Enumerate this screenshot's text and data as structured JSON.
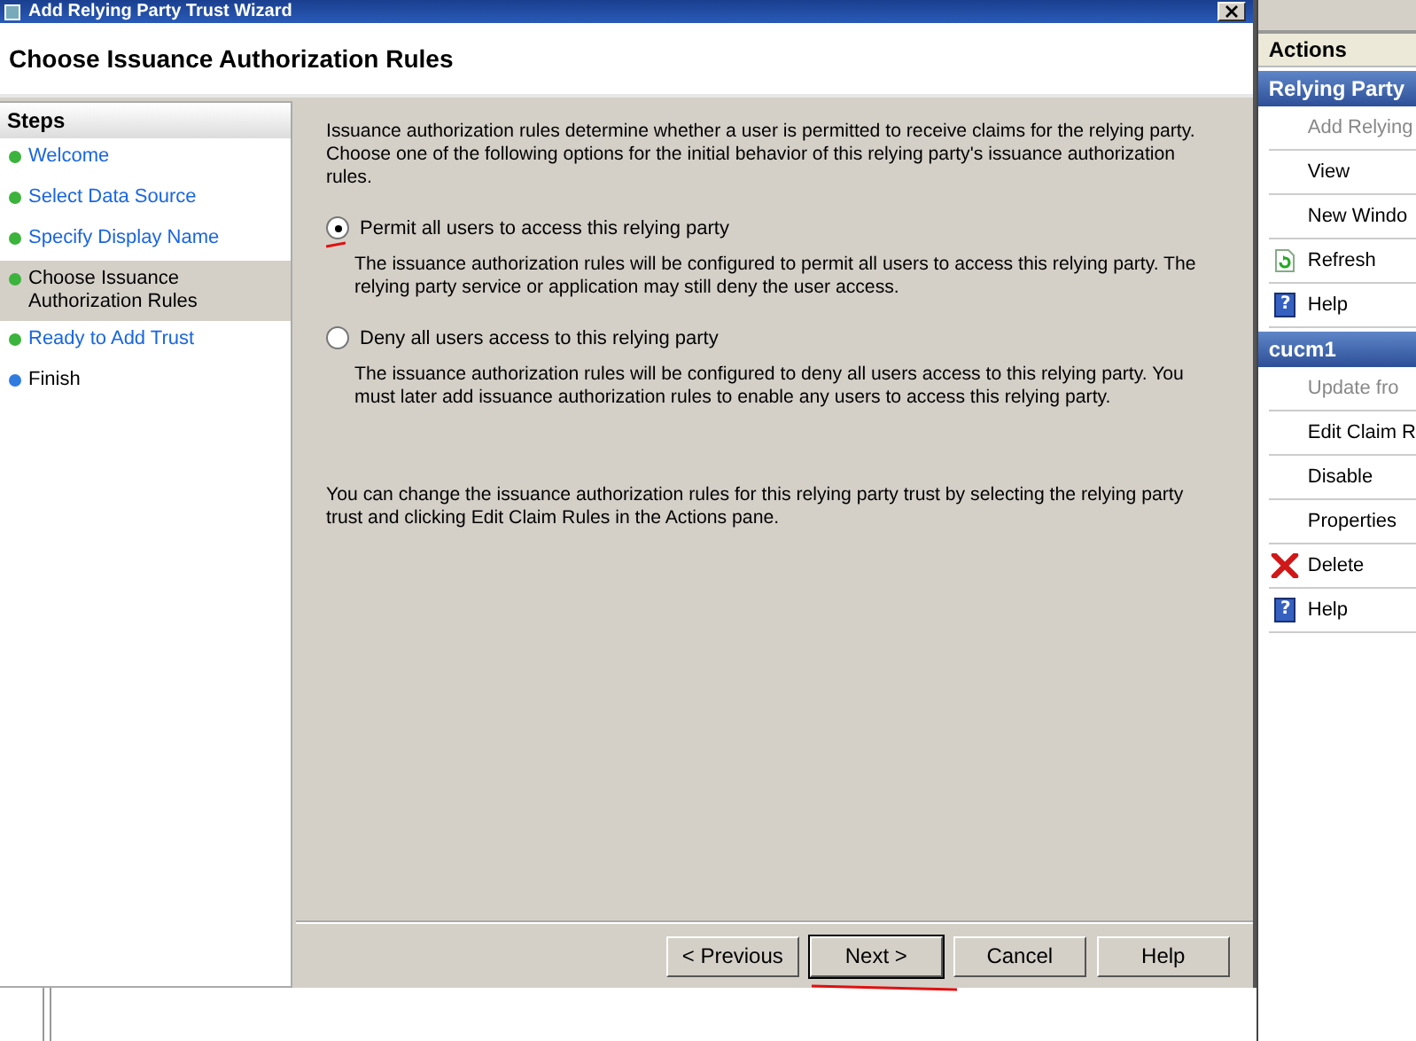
{
  "window": {
    "title": "Add Relying Party Trust Wizard"
  },
  "page_title": "Choose Issuance Authorization Rules",
  "steps": {
    "heading": "Steps",
    "items": [
      {
        "label": "Welcome",
        "kind": "link",
        "color": "#3cb33c",
        "selected": false
      },
      {
        "label": "Select Data Source",
        "kind": "link",
        "color": "#3cb33c",
        "selected": false
      },
      {
        "label": "Specify Display Name",
        "kind": "link",
        "color": "#3cb33c",
        "selected": false
      },
      {
        "label": "Choose Issuance Authorization Rules",
        "kind": "text",
        "color": "#3cb33c",
        "selected": true
      },
      {
        "label": "Ready to Add Trust",
        "kind": "link",
        "color": "#3cb33c",
        "selected": false
      },
      {
        "label": "Finish",
        "kind": "text",
        "color": "#2f7be0",
        "selected": false
      }
    ]
  },
  "intro": "Issuance authorization rules determine whether a user is permitted to receive claims for the relying party. Choose one of the following options for the initial behavior of this relying party's issuance authorization rules.",
  "options": [
    {
      "label": "Permit all users to access this relying party",
      "description": "The issuance authorization rules will be configured to permit all users to access this relying party. The relying party service or application may still deny the user access.",
      "selected": true
    },
    {
      "label": "Deny all users access to this relying party",
      "description": "The issuance authorization rules will be configured to deny all users access to this relying party. You must later add issuance authorization rules to enable any users to access this relying party.",
      "selected": false
    }
  ],
  "footnote": "You can change the issuance authorization rules for this relying party trust by selecting the relying party trust and clicking Edit Claim Rules in the Actions pane.",
  "buttons": [
    {
      "label": "< Previous",
      "default": false
    },
    {
      "label": "Next >",
      "default": true
    },
    {
      "label": "Cancel",
      "default": false
    },
    {
      "label": "Help",
      "default": false
    }
  ],
  "actions": {
    "heading": "Actions",
    "sections": [
      {
        "title": "Relying Party",
        "items": [
          {
            "label": "Add Relying",
            "kind": "plain",
            "disabled": true
          },
          {
            "label": "View",
            "kind": "plain",
            "disabled": false
          },
          {
            "label": "New Windo",
            "kind": "plain",
            "disabled": false
          },
          {
            "label": "Refresh",
            "kind": "refresh",
            "disabled": false
          },
          {
            "label": "Help",
            "kind": "help",
            "glyph": "?",
            "disabled": false
          }
        ]
      },
      {
        "title": "cucm1",
        "items": [
          {
            "label": "Update fro",
            "kind": "plain",
            "disabled": true
          },
          {
            "label": "Edit Claim R",
            "kind": "plain",
            "disabled": false
          },
          {
            "label": "Disable",
            "kind": "plain",
            "disabled": false
          },
          {
            "label": "Properties",
            "kind": "plain",
            "disabled": false
          },
          {
            "label": "Delete",
            "kind": "delete",
            "disabled": false
          },
          {
            "label": "Help",
            "kind": "help",
            "glyph": "?",
            "disabled": false
          }
        ]
      }
    ]
  }
}
